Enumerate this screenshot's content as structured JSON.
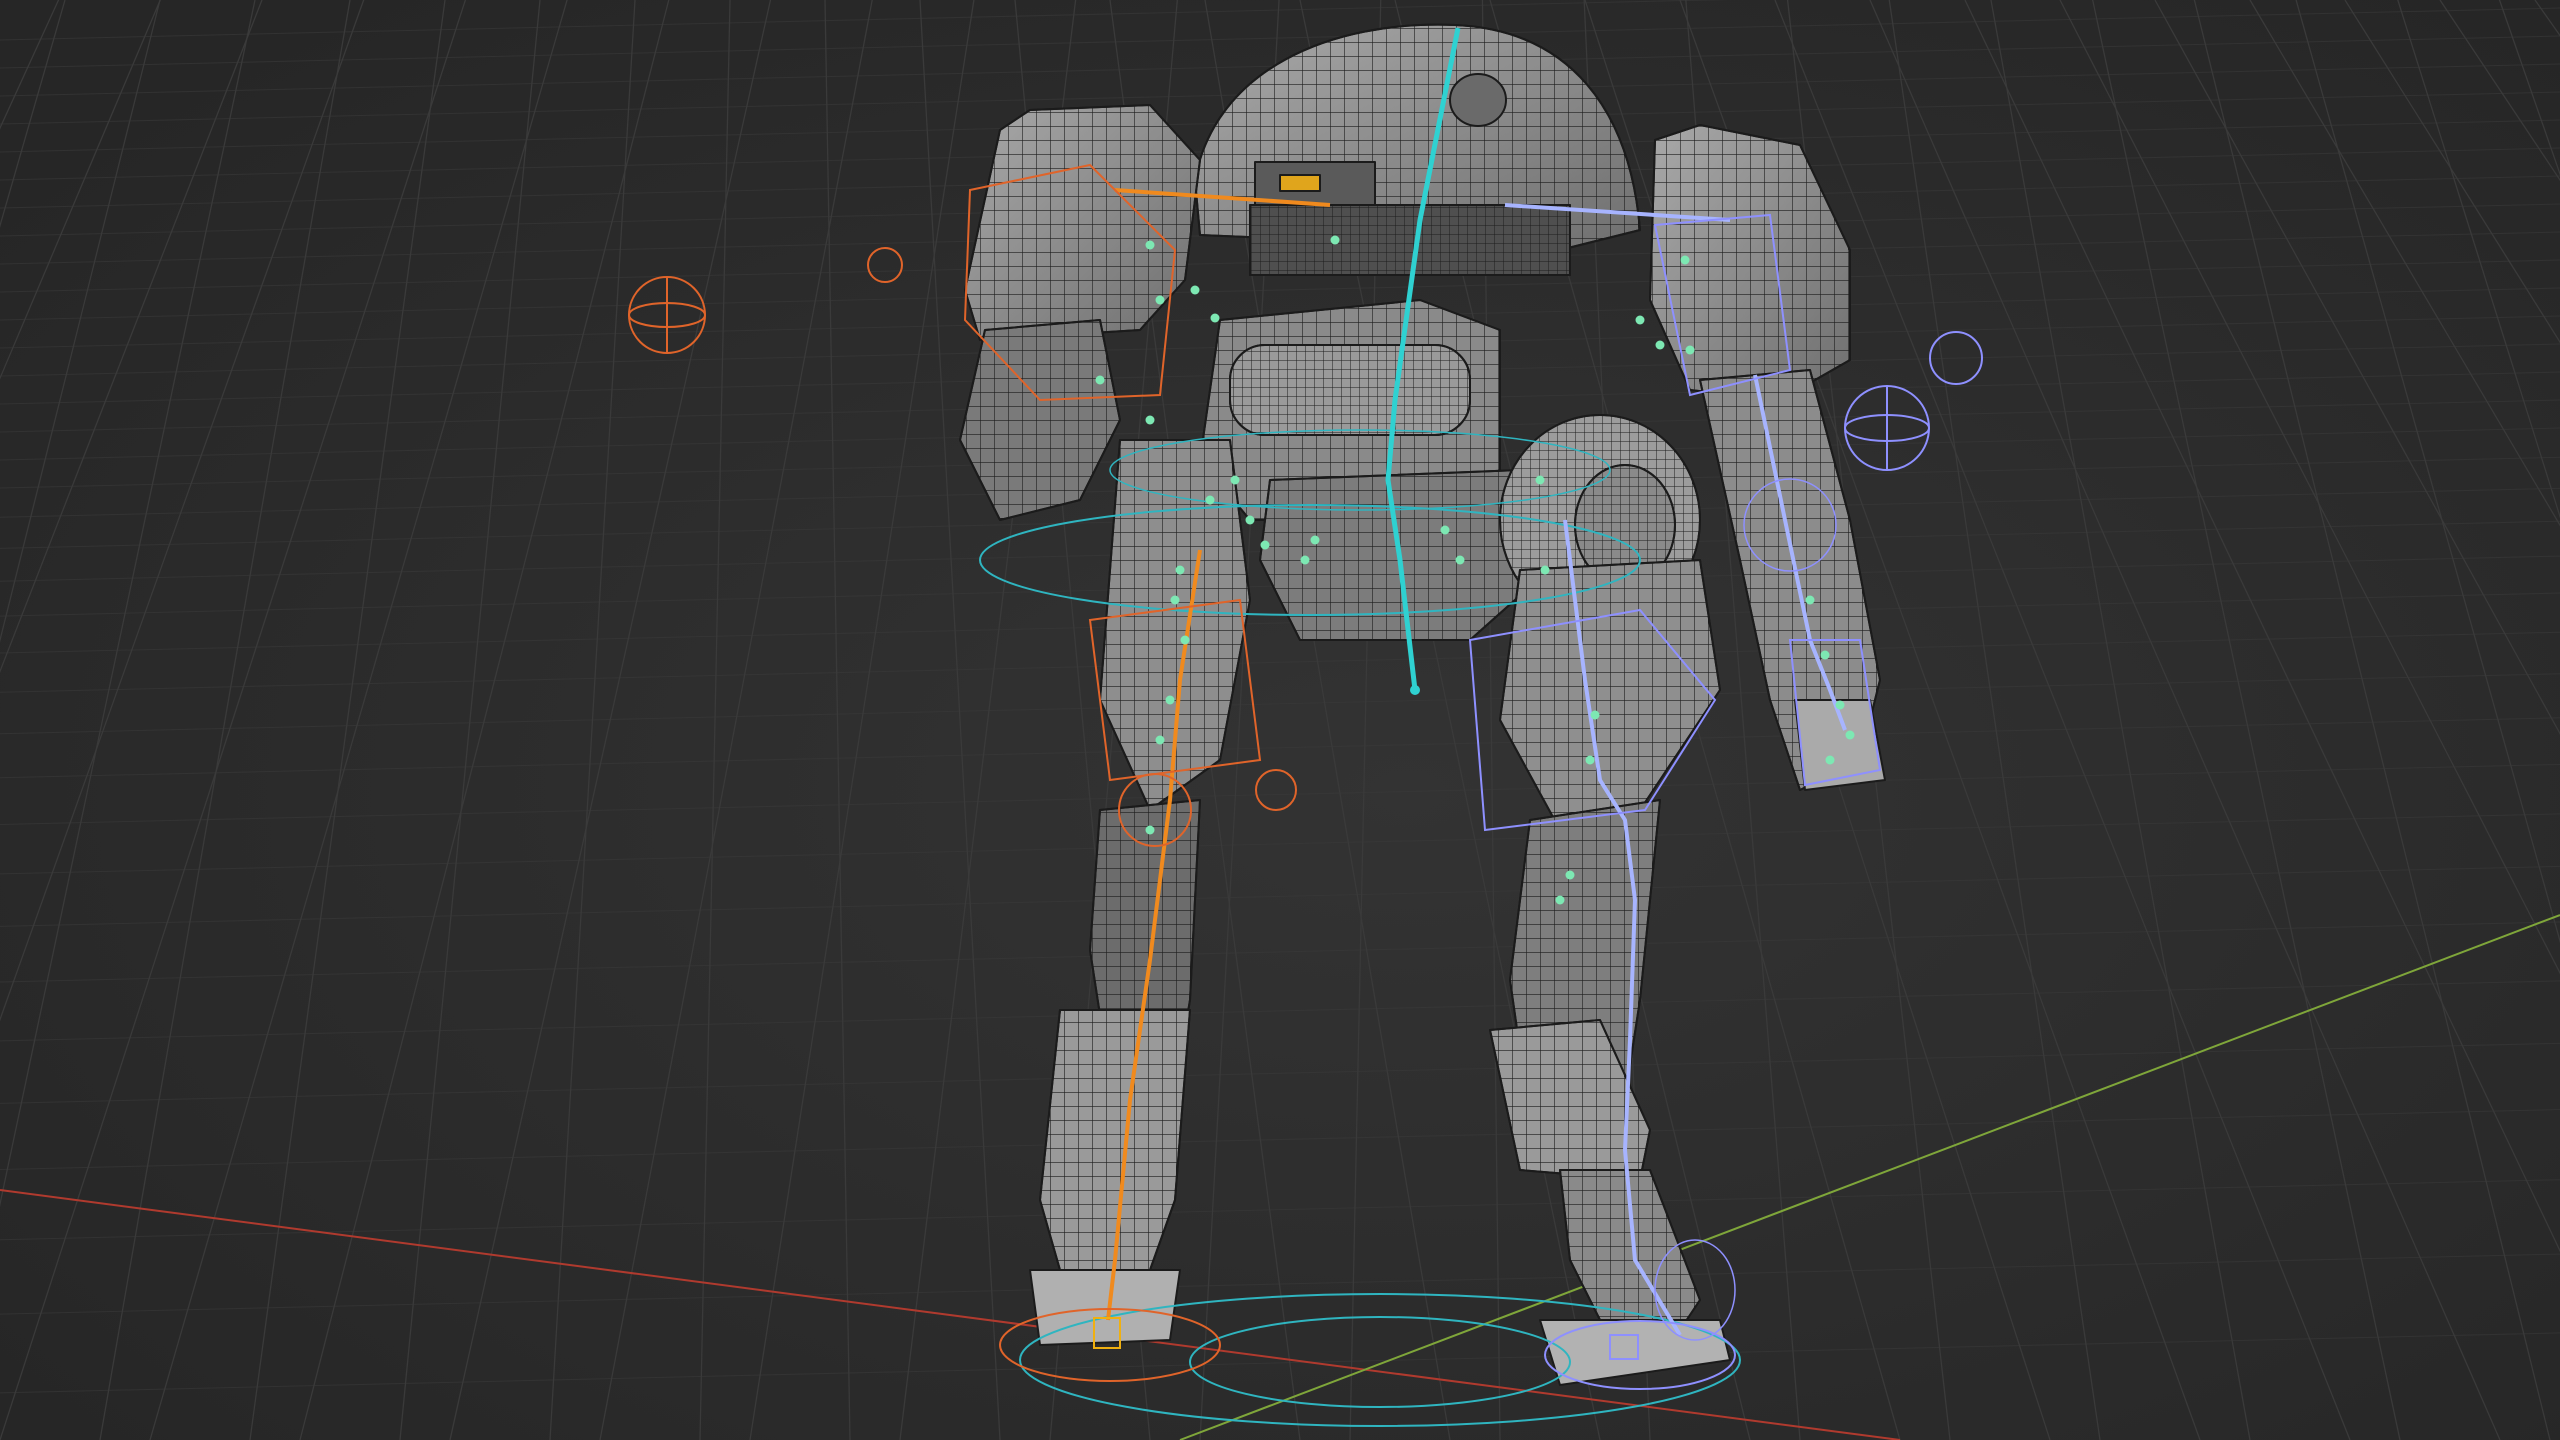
{
  "viewport": {
    "name": "3D Viewport",
    "background": "#2b2b2b",
    "grid_color": "#3a3a3a",
    "axis_x_color": "#c0392b",
    "axis_y_color": "#8db83a"
  },
  "model": {
    "name": "robot-mech",
    "shading": "solid-wireframe",
    "mesh_color": "#8f8f8f",
    "wire_color": "#1f1f1f"
  },
  "rig": {
    "spine_color": "#2fd1d1",
    "left_chain_color": "#f08a1e",
    "right_chain_color": "#a7b4ff",
    "ik_control_color": "#e0642a",
    "pole_target_color": "#8e90ff",
    "joint_color": "#7de8b3",
    "root_circle_color": "#2fb5c0"
  }
}
